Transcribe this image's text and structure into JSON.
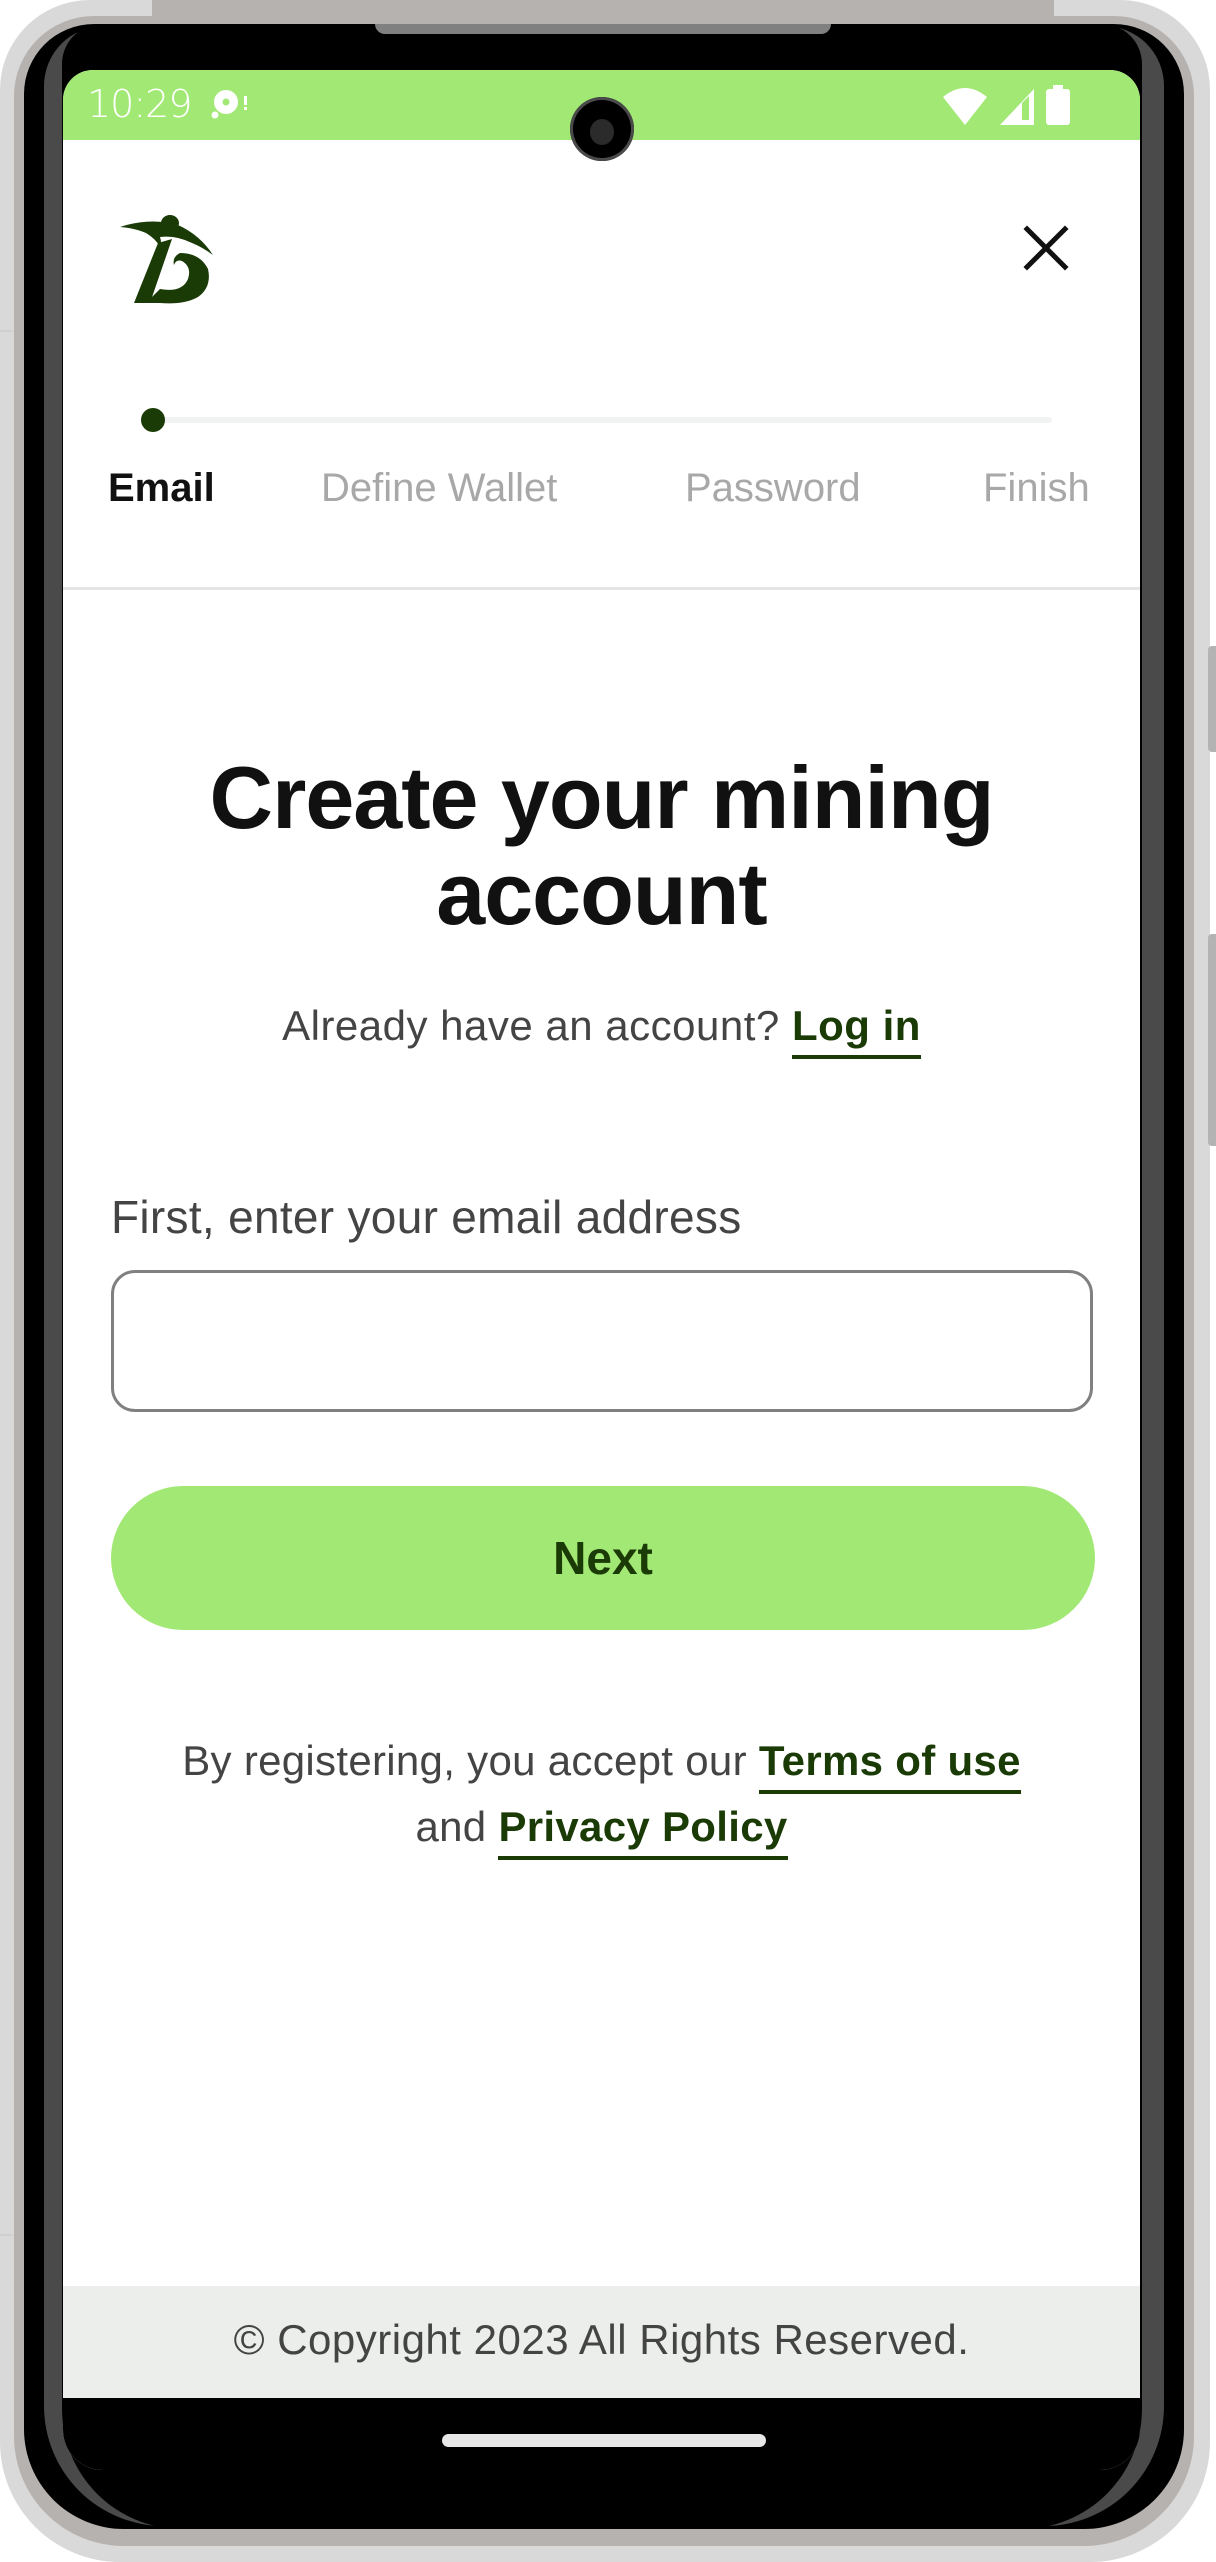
{
  "status_bar": {
    "time": "10:29",
    "left_icons": [
      "notification-disc-icon"
    ],
    "right_icons": [
      "wifi-icon",
      "cell-signal-icon",
      "battery-icon"
    ],
    "background_color": "#a2e874"
  },
  "header": {
    "logo": "brand-logo-d-figure",
    "close_icon": "close-icon"
  },
  "stepper": {
    "current_step": 1,
    "total_steps": 4,
    "steps": [
      {
        "label": "Email",
        "active": true
      },
      {
        "label": "Define Wallet",
        "active": false
      },
      {
        "label": "Password",
        "active": false
      },
      {
        "label": "Finish",
        "active": false
      }
    ]
  },
  "main": {
    "title_line1": "Create your mining",
    "title_line2": "account",
    "login_prompt": "Already have an account?",
    "login_link": "Log in",
    "email_label": "First, enter your email address",
    "email_value": "",
    "email_placeholder": "",
    "next_button": "Next",
    "terms_prefix": "By registering, you accept our",
    "terms_link": "Terms of use",
    "terms_and": "and",
    "privacy_link": "Privacy Policy"
  },
  "footer": {
    "copyright": "© Copyright 2023 All Rights Reserved."
  },
  "colors": {
    "accent": "#a2e874",
    "brand_dark_green": "#1a3a06",
    "text_dark": "#111111",
    "text_muted": "#444444",
    "step_inactive": "#a8a8a8",
    "footer_bg": "#eceeeb"
  }
}
